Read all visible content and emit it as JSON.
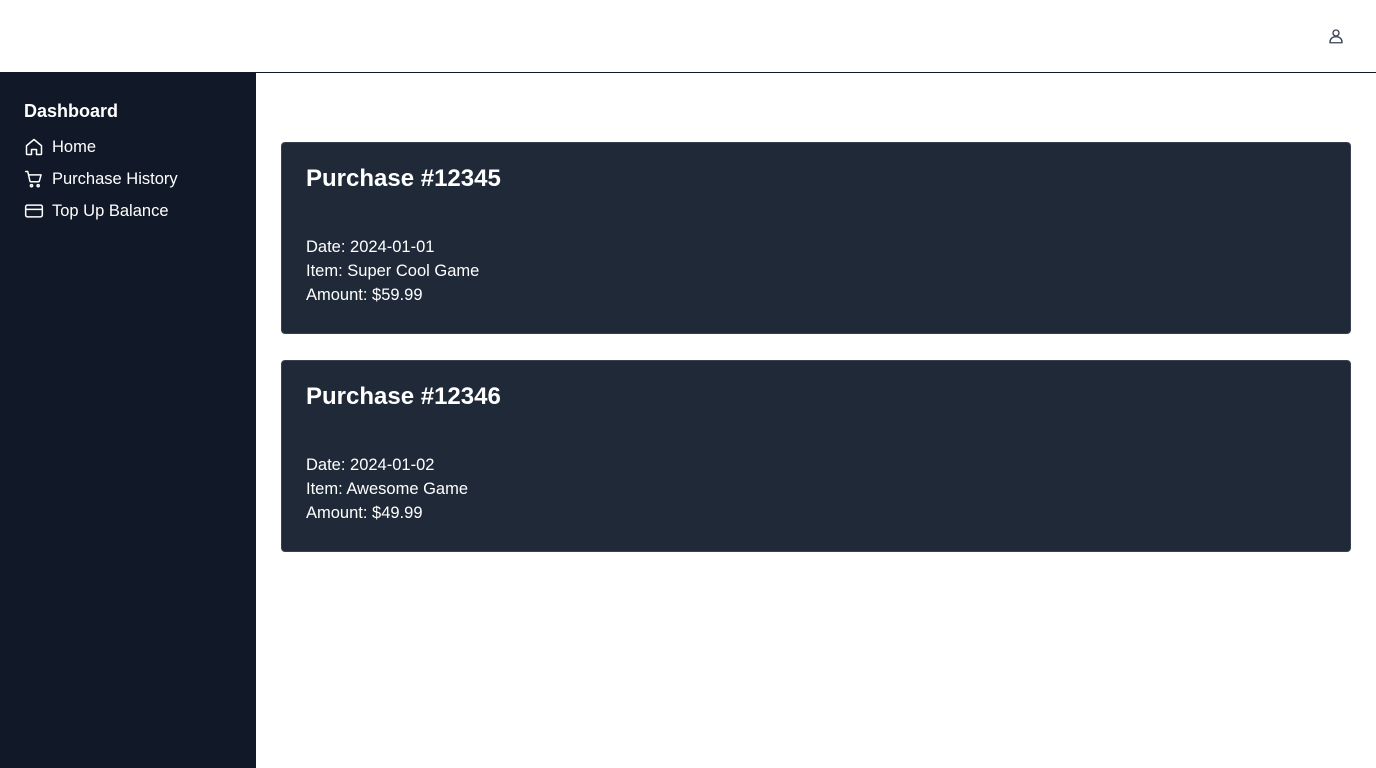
{
  "sidebar": {
    "title": "Dashboard",
    "items": [
      {
        "label": "Home",
        "icon": "home-icon"
      },
      {
        "label": "Purchase History",
        "icon": "cart-icon"
      },
      {
        "label": "Top Up Balance",
        "icon": "credit-card-icon"
      }
    ]
  },
  "header": {
    "user_icon": "user-icon"
  },
  "purchases": [
    {
      "title": "Purchase #12345",
      "date": "Date: 2024-01-01",
      "item": "Item: Super Cool Game",
      "amount": "Amount: $59.99"
    },
    {
      "title": "Purchase #12346",
      "date": "Date: 2024-01-02",
      "item": "Item: Awesome Game",
      "amount": "Amount: $49.99"
    }
  ],
  "colors": {
    "sidebar_bg": "#111827",
    "card_bg": "#1f2937",
    "text": "#ffffff"
  }
}
